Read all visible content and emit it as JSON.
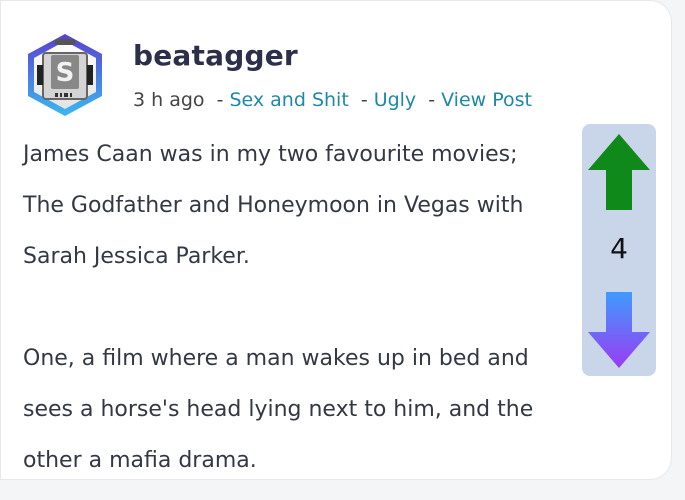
{
  "post": {
    "username": "beatagger",
    "time_ago": "3 h ago",
    "category": "Sex and Shit",
    "tag": "Ugly",
    "view_link": "View Post",
    "separator": "-",
    "avatar_letter": "S",
    "paragraphs": [
      "James Caan was in my two favourite movies; The Godfather and Honeymoon in Vegas with Sarah Jessica Parker.",
      "One, a film where a man wakes up in bed and sees a horse's head lying next to him, and the other a mafia drama."
    ]
  },
  "vote": {
    "count": "4",
    "up_icon": "arrow-up-icon",
    "down_icon": "arrow-down-icon",
    "up_color": "#0f8a1a",
    "down_gradient": [
      "#3f9bff",
      "#9a3cf2"
    ]
  }
}
